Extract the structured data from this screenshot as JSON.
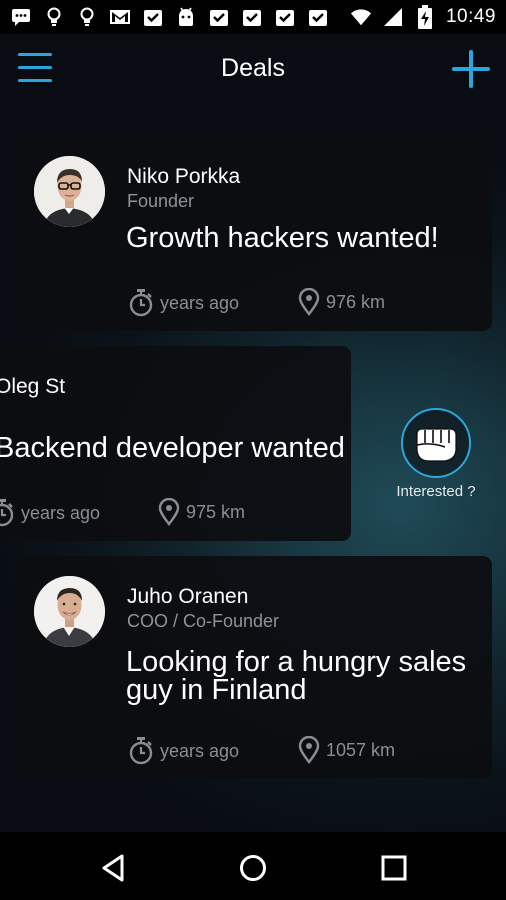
{
  "status_bar": {
    "time": "10:49",
    "left_icons": [
      "chat-bubble-icon",
      "bulb-icon",
      "bulb-icon",
      "mail-icon",
      "check-inbox-icon",
      "android-icon",
      "check-inbox-icon",
      "check-inbox-icon",
      "check-inbox-icon",
      "check-inbox-icon"
    ],
    "right_icons": [
      "wifi-icon",
      "cell-signal-icon",
      "battery-charging-icon"
    ]
  },
  "header": {
    "title": "Deals",
    "menu_icon": "hamburger-menu-icon",
    "add_icon": "plus-icon"
  },
  "deals": [
    {
      "name": "Niko Porkka",
      "role": "Founder",
      "headline": "Growth hackers wanted!",
      "time_ago": "years ago",
      "distance": "976 km",
      "avatar": "avatar-man-glasses"
    },
    {
      "name": "Oleg St",
      "role": "",
      "headline": "Backend developer wanted",
      "time_ago": "years ago",
      "distance": "975 km"
    },
    {
      "name": "Juho Oranen",
      "role": "COO / Co-Founder",
      "headline": "Looking for a hungry sales guy in Finland",
      "time_ago": "years ago",
      "distance": "1057 km",
      "avatar": "avatar-man-smiling"
    }
  ],
  "interested": {
    "label": "Interested ?",
    "icon": "fist-icon"
  },
  "nav": {
    "back": "back-icon",
    "home": "home-icon",
    "recents": "recents-icon"
  },
  "colors": {
    "accent": "#2ba6dd",
    "card_bg": "#0c0d10",
    "muted_text": "#8f9397",
    "background_glow": "#1f4b57"
  }
}
